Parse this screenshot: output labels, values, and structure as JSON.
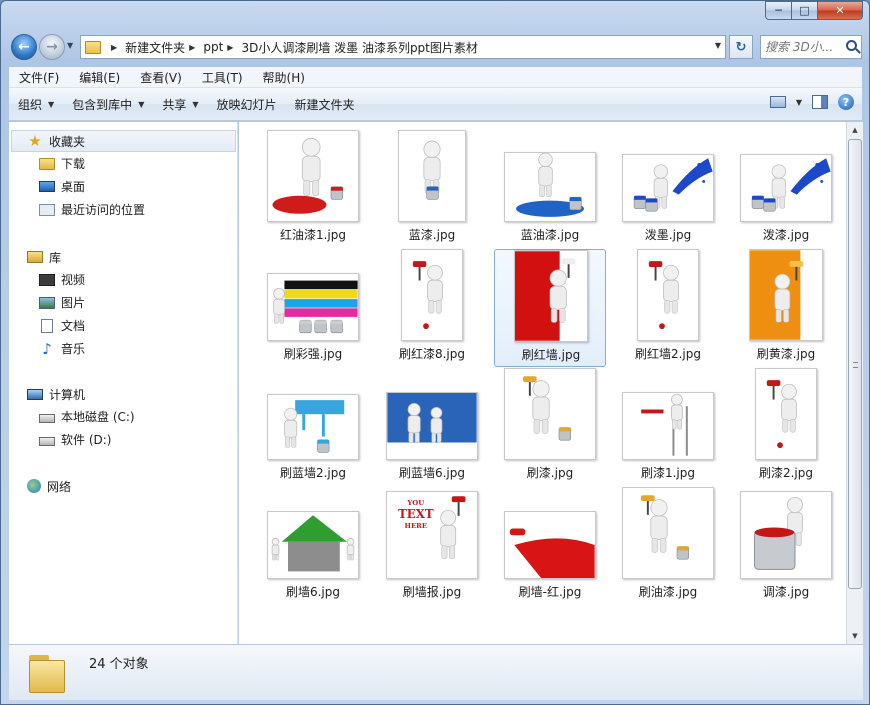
{
  "window": {
    "caption_min": "─",
    "caption_max": "□",
    "caption_close": "✕"
  },
  "nav": {
    "back_glyph": "←",
    "forward_glyph": "→",
    "breadcrumbs": [
      "新建文件夹",
      "ppt",
      "3D小人调漆刷墙 泼墨 油漆系列ppt图片素材"
    ],
    "refresh_glyph": "↻",
    "search_placeholder": "搜索 3D小..."
  },
  "menubar": [
    "文件(F)",
    "编辑(E)",
    "查看(V)",
    "工具(T)",
    "帮助(H)"
  ],
  "toolbar": {
    "organize": "组织",
    "include_in_library": "包含到库中",
    "share": "共享",
    "slideshow": "放映幻灯片",
    "new_folder": "新建文件夹",
    "help": "?"
  },
  "navpane": {
    "favorites": {
      "label": "收藏夹",
      "items": [
        "下载",
        "桌面",
        "最近访问的位置"
      ]
    },
    "libraries": {
      "label": "库",
      "items": [
        "视频",
        "图片",
        "文档",
        "音乐"
      ]
    },
    "computer": {
      "label": "计算机",
      "items": [
        "本地磁盘 (C:)",
        "软件 (D:)"
      ]
    },
    "network": {
      "label": "网络"
    }
  },
  "files": [
    {
      "name": "红油漆1.jpg",
      "theme": "red-paint-pour",
      "accent": "#d11a1a"
    },
    {
      "name": "蓝漆.jpg",
      "theme": "blue-bucket",
      "accent": "#1f63c4"
    },
    {
      "name": "蓝油漆.jpg",
      "theme": "blue-paint-pour",
      "accent": "#1f63c4"
    },
    {
      "name": "泼墨.jpg",
      "theme": "blue-splash",
      "accent": "#1d48c9"
    },
    {
      "name": "泼漆.jpg",
      "theme": "blue-splash",
      "accent": "#1d48c9"
    },
    {
      "name": "刷彩强.jpg",
      "theme": "rainbow",
      "accent": "#e02ea0"
    },
    {
      "name": "刷红漆8.jpg",
      "theme": "red-roller",
      "accent": "#c41818"
    },
    {
      "name": "刷红墙.jpg",
      "theme": "red-wall",
      "accent": "#d21010"
    },
    {
      "name": "刷红墙2.jpg",
      "theme": "red-roller",
      "accent": "#c41818"
    },
    {
      "name": "刷黄漆.jpg",
      "theme": "orange-wall",
      "accent": "#ee8f12"
    },
    {
      "name": "刷蓝墙2.jpg",
      "theme": "blue-drip",
      "accent": "#38a6dd"
    },
    {
      "name": "刷蓝墙6.jpg",
      "theme": "blue-wall",
      "accent": "#2a64b8"
    },
    {
      "name": "刷漆.jpg",
      "theme": "yellow-roller",
      "accent": "#e3a82a"
    },
    {
      "name": "刷漆1.jpg",
      "theme": "ladder",
      "accent": "#c41818"
    },
    {
      "name": "刷漆2.jpg",
      "theme": "red-roller",
      "accent": "#c41818"
    },
    {
      "name": "刷墙6.jpg",
      "theme": "green-house",
      "accent": "#2e9e2e"
    },
    {
      "name": "刷墙报.jpg",
      "theme": "text-poster",
      "accent": "#c41818",
      "poster_text": [
        "YOU",
        "TEXT",
        "HERE"
      ]
    },
    {
      "name": "刷墙-红.jpg",
      "theme": "red-floor",
      "accent": "#d91414"
    },
    {
      "name": "刷油漆.jpg",
      "theme": "yellow-roller",
      "accent": "#e3a82a"
    },
    {
      "name": "调漆.jpg",
      "theme": "mixing",
      "accent": "#c41818"
    },
    {
      "name": "",
      "theme": "paint-cans",
      "accent": "#7a3a8c"
    },
    {
      "name": "",
      "theme": "blank",
      "accent": "#cccccc"
    },
    {
      "name": "",
      "theme": "group",
      "accent": "#cccccc"
    },
    {
      "name": "",
      "theme": "santa",
      "accent": "#c41818"
    }
  ],
  "details": {
    "count_text": "24 个对象"
  }
}
